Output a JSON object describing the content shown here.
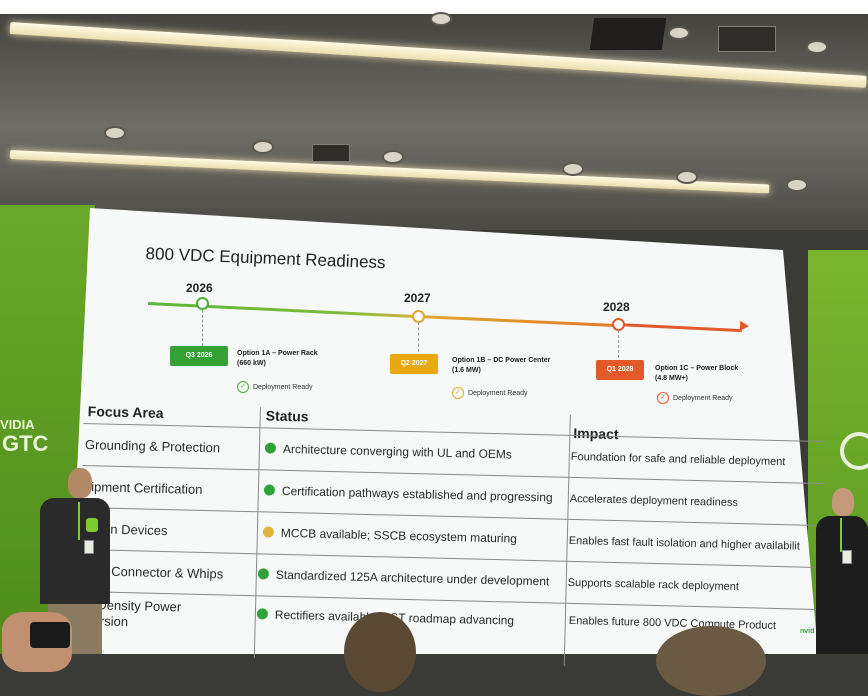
{
  "slide": {
    "title": "800 VDC Equipment Readiness",
    "timeline": [
      {
        "year": "2026",
        "badge": "Q3 2026",
        "color": "#35a033",
        "option": "Option 1A – Power Rack",
        "detail": "(660 kW)",
        "status": "Deployment Ready"
      },
      {
        "year": "2027",
        "badge": "Q2 2027",
        "color": "#e8a812",
        "option": "Option 1B – DC Power Center",
        "detail": "(1.6 MW)",
        "status": "Deployment Ready"
      },
      {
        "year": "2028",
        "badge": "Q1 2028",
        "color": "#e25a2b",
        "option": "Option 1C – Power Block",
        "detail": "(4.8 MW+)",
        "status": "Deployment Ready"
      }
    ],
    "table": {
      "headers": [
        "Focus Area",
        "Status",
        "Impact"
      ],
      "rows": [
        {
          "area": "Grounding & Protection",
          "status": "Architecture converging with UL and OEMs",
          "status_color": "#2fa33a",
          "impact": "Foundation for safe and reliable deployment"
        },
        {
          "area": "uipment Certification",
          "status": "Certification pathways established and progressing",
          "status_color": "#2fa33a",
          "impact": "Accelerates deployment readiness"
        },
        {
          "area": "ection Devices",
          "status": "MCCB available; SSCB ecosystem maturing",
          "status_color": "#e0b43a",
          "impact": "Enables fast fault isolation and higher availabilit"
        },
        {
          "area": "way, Connector & Whips",
          "status": "Standardized 125A architecture under development",
          "status_color": "#2fa33a",
          "impact": "Supports scalable rack deployment"
        },
        {
          "area": "-Density Power",
          "area2": "ersion",
          "status": "Rectifiers available; SST roadmap advancing",
          "status_color": "#2fa33a",
          "impact": "Enables future 800 VDC Compute Product"
        }
      ]
    }
  },
  "venue": {
    "left_wall_text": [
      "VIDIA",
      "GTC"
    ],
    "corner_logo": "nvid"
  },
  "colors": {
    "wall_green": "#5c9a22",
    "screen_bg": "#f7f8f8"
  }
}
